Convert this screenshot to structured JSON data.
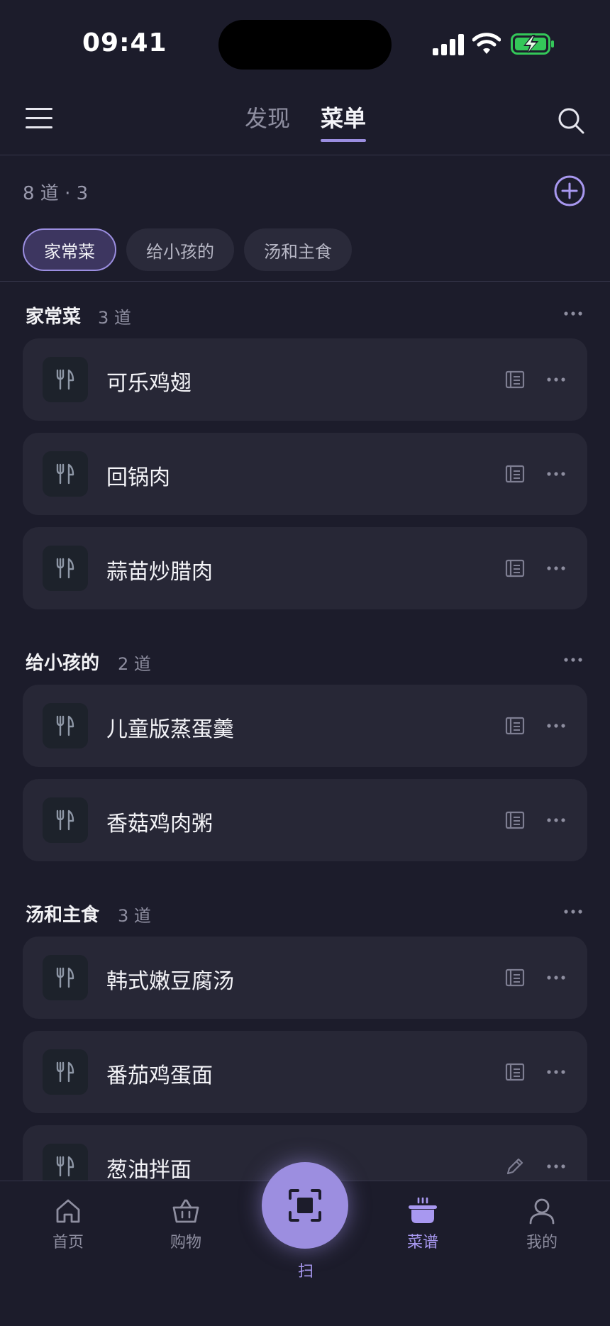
{
  "status_bar": {
    "time": "09:41"
  },
  "header": {
    "tabs": [
      {
        "label": "发现",
        "active": false
      },
      {
        "label": "菜单",
        "active": true
      }
    ]
  },
  "summary": "8 道 · 3",
  "chips": [
    {
      "label": "家常菜",
      "active": true
    },
    {
      "label": "给小孩的",
      "active": false
    },
    {
      "label": "汤和主食",
      "active": false
    }
  ],
  "sections": [
    {
      "title": "家常菜",
      "count": "3 道",
      "items": [
        {
          "name": "可乐鸡翅",
          "action_icon": "recipe-icon"
        },
        {
          "name": "回锅肉",
          "action_icon": "recipe-icon"
        },
        {
          "name": "蒜苗炒腊肉",
          "action_icon": "recipe-icon"
        }
      ]
    },
    {
      "title": "给小孩的",
      "count": "2 道",
      "items": [
        {
          "name": "儿童版蒸蛋羹",
          "action_icon": "recipe-icon"
        },
        {
          "name": "香菇鸡肉粥",
          "action_icon": "recipe-icon"
        }
      ]
    },
    {
      "title": "汤和主食",
      "count": "3 道",
      "items": [
        {
          "name": "韩式嫩豆腐汤",
          "action_icon": "recipe-icon"
        },
        {
          "name": "番茄鸡蛋面",
          "action_icon": "recipe-icon"
        },
        {
          "name": "葱油拌面",
          "action_icon": "edit-icon"
        }
      ]
    }
  ],
  "bottom_nav": {
    "home": "首页",
    "shopping": "购物",
    "scan": "扫",
    "recipes": "菜谱",
    "me": "我的",
    "active": "recipes"
  },
  "colors": {
    "background": "#1c1c2b",
    "card": "#272736",
    "accent": "#9b8ee0",
    "battery": "#34c759"
  }
}
